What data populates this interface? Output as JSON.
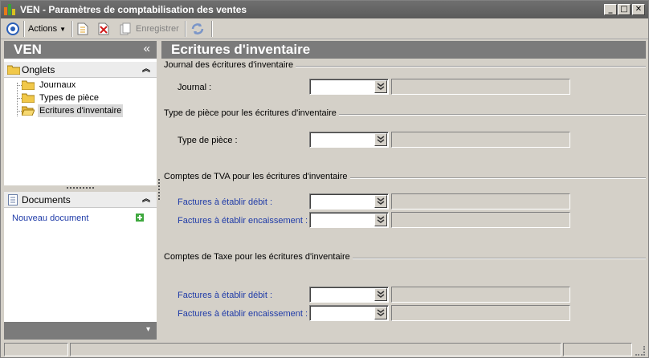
{
  "window": {
    "title": "VEN -  Paramètres de comptabilisation des ventes",
    "minimize_glyph": "_",
    "maximize_glyph": "□",
    "close_glyph": "✕"
  },
  "toolbar": {
    "actions_label": "Actions",
    "save_label": "Enregistrer",
    "icons": [
      "circle-target-icon",
      "new-document-icon",
      "delete-icon",
      "copy-icon",
      "refresh-icon"
    ]
  },
  "left_panel": {
    "header": "VEN",
    "collapse_glyph": "«",
    "tabs_section": {
      "label": "Onglets",
      "chevron": "⌃",
      "items": [
        {
          "label": "Journaux",
          "selected": false
        },
        {
          "label": "Types de pièce",
          "selected": false
        },
        {
          "label": "Ecritures d'inventaire",
          "selected": true
        }
      ]
    },
    "documents_section": {
      "label": "Documents",
      "chevron": "⌃",
      "new_document_label": "Nouveau document"
    },
    "footer_glyph": "▾"
  },
  "main": {
    "title": "Ecritures d'inventaire",
    "groups": {
      "journal": {
        "title": "Journal des écritures d'inventaire",
        "field_label": "Journal :"
      },
      "piece": {
        "title": "Type de pièce pour les écritures d'inventaire",
        "field_label": "Type de pièce :"
      },
      "tva": {
        "title": "Comptes de TVA pour les écritures d'inventaire",
        "debit_label": "Factures à établir débit :",
        "encaissement_label": "Factures à établir encaissement :"
      },
      "taxe": {
        "title": "Comptes de Taxe pour les écritures d'inventaire",
        "debit_label": "Factures à établir débit :",
        "encaissement_label": "Factures à établir encaissement :"
      }
    }
  },
  "colors": {
    "link_blue": "#1f3ba8",
    "header_gray": "#7b7b7b",
    "window_bg": "#d4d0c8"
  }
}
